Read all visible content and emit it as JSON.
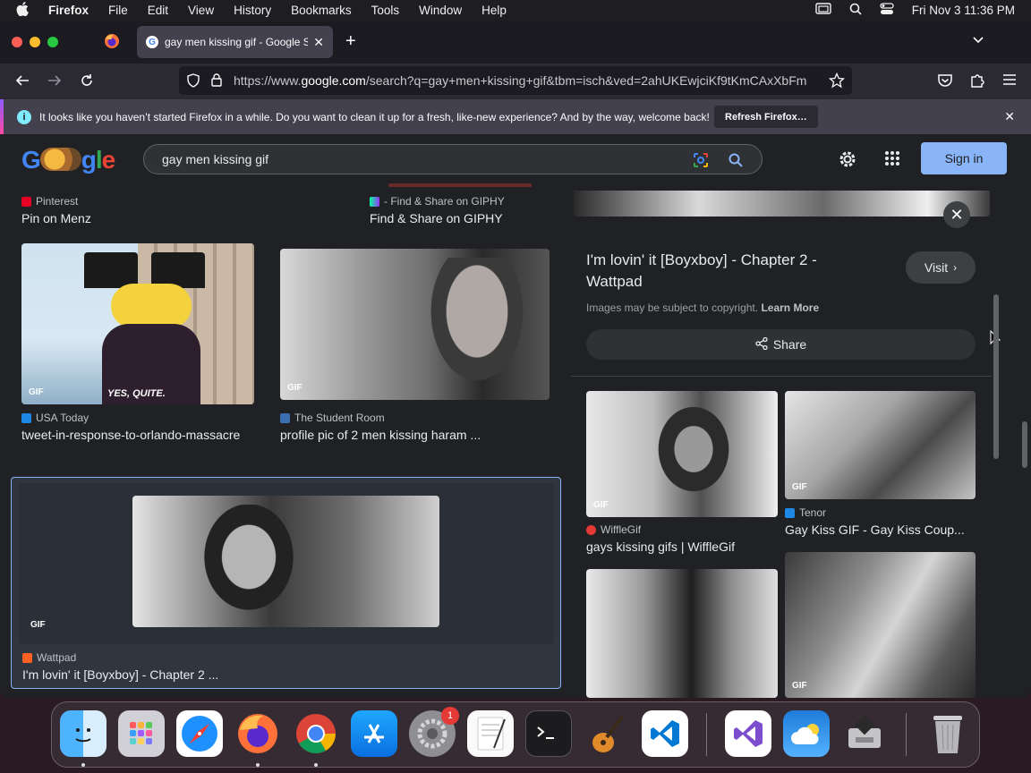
{
  "menubar": {
    "app": "Firefox",
    "items": [
      "File",
      "Edit",
      "View",
      "History",
      "Bookmarks",
      "Tools",
      "Window",
      "Help"
    ],
    "clock": "Fri Nov 3  11:36 PM"
  },
  "browser": {
    "tab_title": "gay men kissing gif - Google Se",
    "url_prefix": "https://www.",
    "url_domain": "google.com",
    "url_rest": "/search?q=gay+men+kissing+gif&tbm=isch&ved=2ahUKEwjciKf9tKmCAxXbFm",
    "notification": "It looks like you haven’t started Firefox in a while. Do you want to clean it up for a fresh, like-new experience? And by the way, welcome back!",
    "refresh_button": "Refresh Firefox…"
  },
  "google": {
    "logo": "Google",
    "query": "gay men kissing gif",
    "sign_in": "Sign in"
  },
  "results": [
    {
      "source": "Pinterest",
      "caption": "Pin on Menz"
    },
    {
      "source": "- Find & Share on GIPHY",
      "caption": "Find & Share on GIPHY"
    },
    {
      "source": "USA Today",
      "caption": "tweet-in-response-to-orlando-massacre",
      "overlay": "YES, QUITE."
    },
    {
      "source": "The Student Room",
      "caption": "profile pic of 2 men kissing haram ..."
    },
    {
      "source": "Wattpad",
      "caption": "I'm lovin' it [Boyxboy] - Chapter 2 ..."
    }
  ],
  "gif_label": "GIF",
  "preview": {
    "title": "I'm lovin' it [Boyxboy] - Chapter 2 - Wattpad",
    "visit": "Visit",
    "copyright": "Images may be subject to copyright.",
    "learn_more": "Learn More",
    "share": "Share",
    "related": [
      {
        "source": "WiffleGif",
        "caption": "gays kissing gifs | WiffleGif"
      },
      {
        "source": "Tenor",
        "caption": "Gay Kiss GIF - Gay Kiss Coup..."
      }
    ]
  },
  "dock": {
    "settings_badge": "1"
  }
}
